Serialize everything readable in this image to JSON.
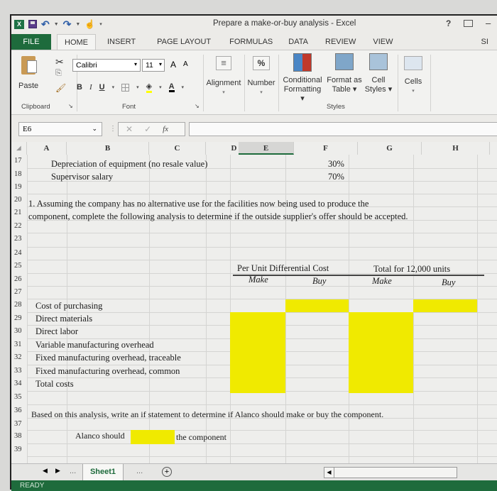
{
  "window": {
    "title": "Prepare a make-or-buy analysis - Excel",
    "help": "?",
    "minimize": "–"
  },
  "qat": {
    "app_icon": "X",
    "undo": "↶",
    "redo": "↷"
  },
  "tabs": [
    "FILE",
    "HOME",
    "INSERT",
    "PAGE LAYOUT",
    "FORMULAS",
    "DATA",
    "REVIEW",
    "VIEW",
    "SI"
  ],
  "ribbon": {
    "clipboard": {
      "paste": "Paste",
      "label": "Clipboard"
    },
    "font": {
      "name": "Calibri",
      "size": "11",
      "grow": "A",
      "shrink": "A",
      "bold": "B",
      "italic": "I",
      "underline": "U",
      "font_color": "A",
      "label": "Font"
    },
    "alignment": {
      "label": "Alignment",
      "icon": "≡"
    },
    "number": {
      "label": "Number",
      "icon": "%"
    },
    "styles": {
      "conditional": [
        "Conditional",
        "Formatting ▾"
      ],
      "format_table": [
        "Format as",
        "Table ▾"
      ],
      "cell_styles": [
        "Cell",
        "Styles ▾"
      ],
      "label": "Styles"
    },
    "cells": {
      "label": "Cells"
    }
  },
  "formula_bar": {
    "name_box": "E6",
    "cancel": "✕",
    "enter": "✓",
    "fx": "fx",
    "value": ""
  },
  "columns": [
    "A",
    "B",
    "C",
    "D",
    "E",
    "F",
    "G",
    "H"
  ],
  "rows": [
    "17",
    "18",
    "19",
    "20",
    "21",
    "22",
    "23",
    "24",
    "25",
    "26",
    "27",
    "28",
    "29",
    "30",
    "31",
    "32",
    "33",
    "34",
    "35",
    "36",
    "37",
    "38",
    "39"
  ],
  "cells": {
    "r17_label": "Depreciation of equipment (no resale value)",
    "r17_value": "30%",
    "r18_label": "Supervisor salary",
    "r18_value": "70%",
    "r20": "1. Assuming the company has no alternative use for the facilities now being used to produce the",
    "r21": "component, complete the following analysis to determine if the outside supplier's offer should be accepted.",
    "per_unit_header": "Per Unit Differential Cost",
    "total_header": "Total for 12,000 units",
    "make": "Make",
    "buy": "Buy",
    "r26": "Cost of purchasing",
    "r27": "Direct materials",
    "r28": "Direct labor",
    "r29": "Variable manufacturing overhead",
    "r30": "Fixed manufacturing overhead, traceable",
    "r31": "Fixed manufacturing overhead, common",
    "r32": "Total costs",
    "r34": "Based on this analysis, write an if statement to determine if Alanco should make or buy the component.",
    "r36_a": "Alanco should",
    "r36_b": "the component"
  },
  "sheet_tabs": {
    "active": "Sheet1",
    "more": "...",
    "add": "+"
  },
  "status": {
    "mode": "READY"
  },
  "colors": {
    "excel_green": "#1e6b3c",
    "input_yellow": "#f0ea00"
  }
}
